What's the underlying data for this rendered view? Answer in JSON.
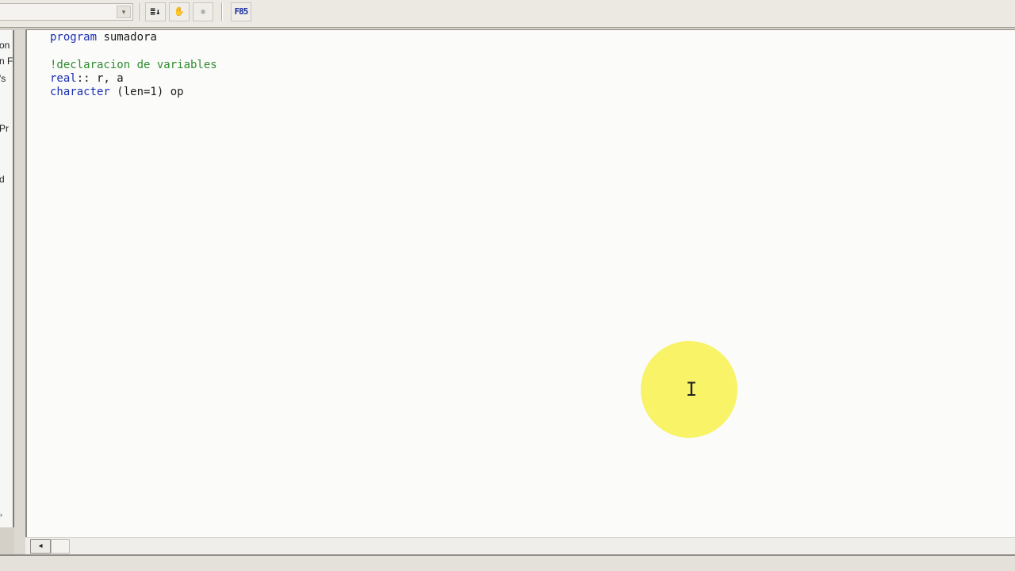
{
  "toolbar": {
    "combo_value": "",
    "combo_arrow": "▾",
    "buttons": [
      {
        "name": "sort-list-icon",
        "glyph": "≣↓"
      },
      {
        "name": "hand-icon",
        "glyph": "✋"
      },
      {
        "name": "disabled-tool-icon",
        "glyph": "✱"
      },
      {
        "name": "f85-icon",
        "glyph": "F85"
      }
    ]
  },
  "left_panel": {
    "fragments": [
      "on",
      "n F",
      "'s",
      "Pr",
      "d"
    ],
    "collapse_arrow": "›"
  },
  "editor": {
    "lines": [
      {
        "tokens": [
          {
            "t": "program",
            "c": "kw"
          },
          {
            "t": " sumadora",
            "c": ""
          }
        ]
      },
      {
        "tokens": [
          {
            "t": "",
            "c": ""
          }
        ]
      },
      {
        "tokens": [
          {
            "t": "!declaracion de variables",
            "c": "cm"
          }
        ]
      },
      {
        "tokens": [
          {
            "t": "real",
            "c": "kw"
          },
          {
            "t": ":: r, a",
            "c": ""
          }
        ]
      },
      {
        "tokens": [
          {
            "t": "character",
            "c": "kw"
          },
          {
            "t": " (len=1) op",
            "c": ""
          }
        ]
      }
    ]
  },
  "scrollbar": {
    "left_arrow": "◂"
  },
  "cursor": {
    "glyph": "I"
  },
  "colors": {
    "keyword": "#1a2fb0",
    "comment": "#2e8b2e",
    "highlight": "#f7f25a"
  }
}
